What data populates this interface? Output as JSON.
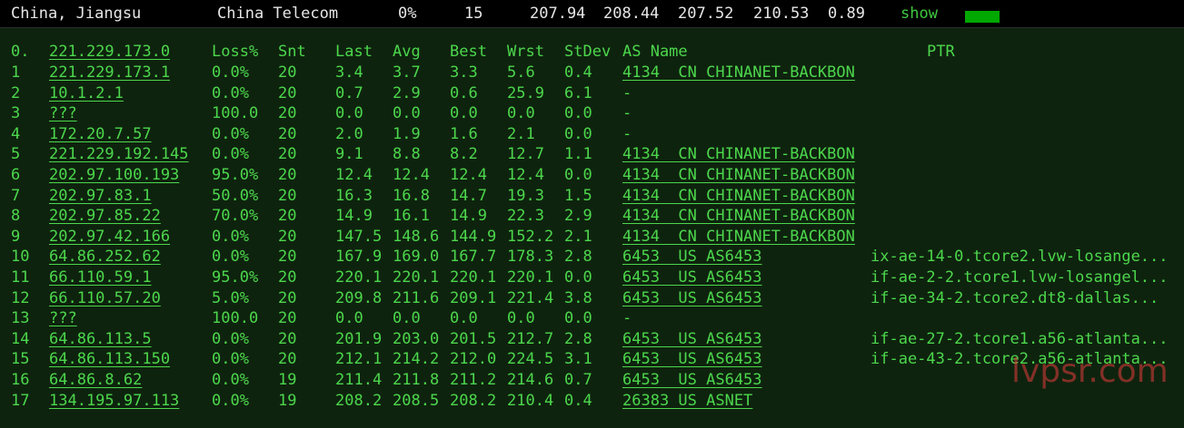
{
  "summary": {
    "location": "China, Jiangsu",
    "isp": "China Telecom",
    "loss": "0%",
    "sent": "15",
    "last": "207.94",
    "avg": "208.44",
    "best": "207.52",
    "worst": "210.53",
    "stdev": "0.89",
    "show_label": "show"
  },
  "colors": {
    "text": "#4cd74c",
    "panel_bg": "#0e230e",
    "bar": "#00a800",
    "header_text": "#e6e6e6"
  },
  "table": {
    "headers": {
      "hop": "0.",
      "host": "221.229.173.0",
      "loss": "Loss%",
      "snt": "Snt",
      "last": "Last",
      "avg": "Avg",
      "best": "Best",
      "wrst": "Wrst",
      "stdev": "StDev",
      "as": "AS Name",
      "ptr": "PTR"
    },
    "rows": [
      {
        "hop": "1",
        "host": "221.229.173.1",
        "loss": "0.0%",
        "snt": "20",
        "last": "3.4",
        "avg": "3.7",
        "best": "3.3",
        "wrst": "5.6",
        "stdev": "0.4",
        "as": "4134  CN CHINANET-BACKBON",
        "ptr": ""
      },
      {
        "hop": "2",
        "host": "10.1.2.1",
        "loss": "0.0%",
        "snt": "20",
        "last": "0.7",
        "avg": "2.9",
        "best": "0.6",
        "wrst": "25.9",
        "stdev": "6.1",
        "as": "-",
        "ptr": ""
      },
      {
        "hop": "3",
        "host": "???",
        "loss": "100.0",
        "snt": "20",
        "last": "0.0",
        "avg": "0.0",
        "best": "0.0",
        "wrst": "0.0",
        "stdev": "0.0",
        "as": "-",
        "ptr": ""
      },
      {
        "hop": "4",
        "host": "172.20.7.57",
        "loss": "0.0%",
        "snt": "20",
        "last": "2.0",
        "avg": "1.9",
        "best": "1.6",
        "wrst": "2.1",
        "stdev": "0.0",
        "as": "-",
        "ptr": ""
      },
      {
        "hop": "5",
        "host": "221.229.192.145",
        "loss": "0.0%",
        "snt": "20",
        "last": "9.1",
        "avg": "8.8",
        "best": "8.2",
        "wrst": "12.7",
        "stdev": "1.1",
        "as": "4134  CN CHINANET-BACKBON",
        "ptr": ""
      },
      {
        "hop": "6",
        "host": "202.97.100.193",
        "loss": "95.0%",
        "snt": "20",
        "last": "12.4",
        "avg": "12.4",
        "best": "12.4",
        "wrst": "12.4",
        "stdev": "0.0",
        "as": "4134  CN CHINANET-BACKBON",
        "ptr": ""
      },
      {
        "hop": "7",
        "host": "202.97.83.1",
        "loss": "50.0%",
        "snt": "20",
        "last": "16.3",
        "avg": "16.8",
        "best": "14.7",
        "wrst": "19.3",
        "stdev": "1.5",
        "as": "4134  CN CHINANET-BACKBON",
        "ptr": ""
      },
      {
        "hop": "8",
        "host": "202.97.85.22",
        "loss": "70.0%",
        "snt": "20",
        "last": "14.9",
        "avg": "16.1",
        "best": "14.9",
        "wrst": "22.3",
        "stdev": "2.9",
        "as": "4134  CN CHINANET-BACKBON",
        "ptr": ""
      },
      {
        "hop": "9",
        "host": "202.97.42.166",
        "loss": "0.0%",
        "snt": "20",
        "last": "147.5",
        "avg": "148.6",
        "best": "144.9",
        "wrst": "152.2",
        "stdev": "2.1",
        "as": "4134  CN CHINANET-BACKBON",
        "ptr": ""
      },
      {
        "hop": "10",
        "host": "64.86.252.62",
        "loss": "0.0%",
        "snt": "20",
        "last": "167.9",
        "avg": "169.0",
        "best": "167.7",
        "wrst": "178.3",
        "stdev": "2.8",
        "as": "6453  US AS6453",
        "ptr": "ix-ae-14-0.tcore2.lvw-losange..."
      },
      {
        "hop": "11",
        "host": "66.110.59.1",
        "loss": "95.0%",
        "snt": "20",
        "last": "220.1",
        "avg": "220.1",
        "best": "220.1",
        "wrst": "220.1",
        "stdev": "0.0",
        "as": "6453  US AS6453",
        "ptr": "if-ae-2-2.tcore1.lvw-losangel..."
      },
      {
        "hop": "12",
        "host": "66.110.57.20",
        "loss": "5.0%",
        "snt": "20",
        "last": "209.8",
        "avg": "211.6",
        "best": "209.1",
        "wrst": "221.4",
        "stdev": "3.8",
        "as": "6453  US AS6453",
        "ptr": "if-ae-34-2.tcore2.dt8-dallas..."
      },
      {
        "hop": "13",
        "host": "???",
        "loss": "100.0",
        "snt": "20",
        "last": "0.0",
        "avg": "0.0",
        "best": "0.0",
        "wrst": "0.0",
        "stdev": "0.0",
        "as": "-",
        "ptr": ""
      },
      {
        "hop": "14",
        "host": "64.86.113.5",
        "loss": "0.0%",
        "snt": "20",
        "last": "201.9",
        "avg": "203.0",
        "best": "201.5",
        "wrst": "212.7",
        "stdev": "2.8",
        "as": "6453  US AS6453",
        "ptr": "if-ae-27-2.tcore1.a56-atlanta..."
      },
      {
        "hop": "15",
        "host": "64.86.113.150",
        "loss": "0.0%",
        "snt": "20",
        "last": "212.1",
        "avg": "214.2",
        "best": "212.0",
        "wrst": "224.5",
        "stdev": "3.1",
        "as": "6453  US AS6453",
        "ptr": "if-ae-43-2.tcore2.a56-atlanta..."
      },
      {
        "hop": "16",
        "host": "64.86.8.62",
        "loss": "0.0%",
        "snt": "19",
        "last": "211.4",
        "avg": "211.8",
        "best": "211.2",
        "wrst": "214.6",
        "stdev": "0.7",
        "as": "6453  US AS6453",
        "ptr": ""
      },
      {
        "hop": "17",
        "host": "134.195.97.113",
        "loss": "0.0%",
        "snt": "19",
        "last": "208.2",
        "avg": "208.5",
        "best": "208.2",
        "wrst": "210.4",
        "stdev": "0.4",
        "as": "26383 US ASNET",
        "ptr": ""
      }
    ]
  },
  "watermark": "lvpsr.com"
}
